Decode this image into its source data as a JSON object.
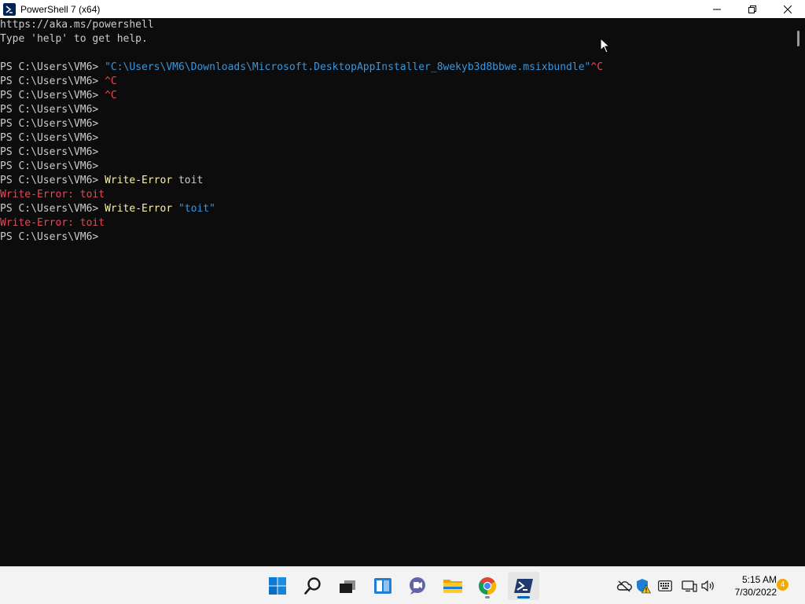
{
  "window": {
    "title": "PowerShell 7 (x64)"
  },
  "console": {
    "lines": [
      [
        {
          "t": "https://aka.ms/powershell",
          "c": "plain"
        }
      ],
      [
        {
          "t": "Type 'help' to get help.",
          "c": "plain"
        }
      ],
      [
        {
          "t": "",
          "c": "plain"
        }
      ],
      [
        {
          "t": "PS C:\\Users\\VM6> ",
          "c": "plain"
        },
        {
          "t": "\"C:\\Users\\VM6\\Downloads\\Microsoft.DesktopAppInstaller_8wekyb3d8bbwe.msixbundle\"",
          "c": "str"
        },
        {
          "t": "^C",
          "c": "err"
        }
      ],
      [
        {
          "t": "PS C:\\Users\\VM6> ",
          "c": "plain"
        },
        {
          "t": "^C",
          "c": "err"
        }
      ],
      [
        {
          "t": "PS C:\\Users\\VM6> ",
          "c": "plain"
        },
        {
          "t": "^C",
          "c": "err"
        }
      ],
      [
        {
          "t": "PS C:\\Users\\VM6>",
          "c": "plain"
        }
      ],
      [
        {
          "t": "PS C:\\Users\\VM6>",
          "c": "plain"
        }
      ],
      [
        {
          "t": "PS C:\\Users\\VM6>",
          "c": "plain"
        }
      ],
      [
        {
          "t": "PS C:\\Users\\VM6>",
          "c": "plain"
        }
      ],
      [
        {
          "t": "PS C:\\Users\\VM6>",
          "c": "plain"
        }
      ],
      [
        {
          "t": "PS C:\\Users\\VM6> ",
          "c": "plain"
        },
        {
          "t": "Write-Error",
          "c": "cmd"
        },
        {
          "t": " toit",
          "c": "plain"
        }
      ],
      [
        {
          "t": "Write-Error: toit",
          "c": "err"
        }
      ],
      [
        {
          "t": "PS C:\\Users\\VM6> ",
          "c": "plain"
        },
        {
          "t": "Write-Error",
          "c": "cmd"
        },
        {
          "t": " ",
          "c": "plain"
        },
        {
          "t": "\"toit\"",
          "c": "str"
        }
      ],
      [
        {
          "t": "Write-Error: toit",
          "c": "err"
        }
      ],
      [
        {
          "t": "PS C:\\Users\\VM6>",
          "c": "plain"
        }
      ]
    ]
  },
  "taskbar": {
    "apps": [
      {
        "name": "start-button",
        "icon": "windows-logo-icon",
        "active": false,
        "running": false
      },
      {
        "name": "search-button",
        "icon": "search-icon",
        "active": false,
        "running": false
      },
      {
        "name": "task-view-button",
        "icon": "task-view-icon",
        "active": false,
        "running": false
      },
      {
        "name": "widgets-button",
        "icon": "widgets-icon",
        "active": false,
        "running": false
      },
      {
        "name": "chat-button",
        "icon": "chat-icon",
        "active": false,
        "running": false
      },
      {
        "name": "file-explorer-button",
        "icon": "folder-icon",
        "active": false,
        "running": false
      },
      {
        "name": "chrome-button",
        "icon": "chrome-icon",
        "active": false,
        "running": true
      },
      {
        "name": "powershell-button",
        "icon": "powershell-icon",
        "active": true,
        "running": true
      }
    ],
    "tray": {
      "icons": [
        "onedrive-offline-icon",
        "security-warning-icon",
        "keyboard-icon",
        "network-icon",
        "volume-icon"
      ]
    },
    "clock": {
      "time": "5:15 AM",
      "date": "7/30/2022"
    },
    "notifications": "4"
  },
  "colors": {
    "console_bg": "#0c0c0c",
    "text": "#cccccc",
    "command": "#f9f1a5",
    "string": "#3a96dd",
    "error": "#e74856",
    "accent": "#0067c0"
  }
}
